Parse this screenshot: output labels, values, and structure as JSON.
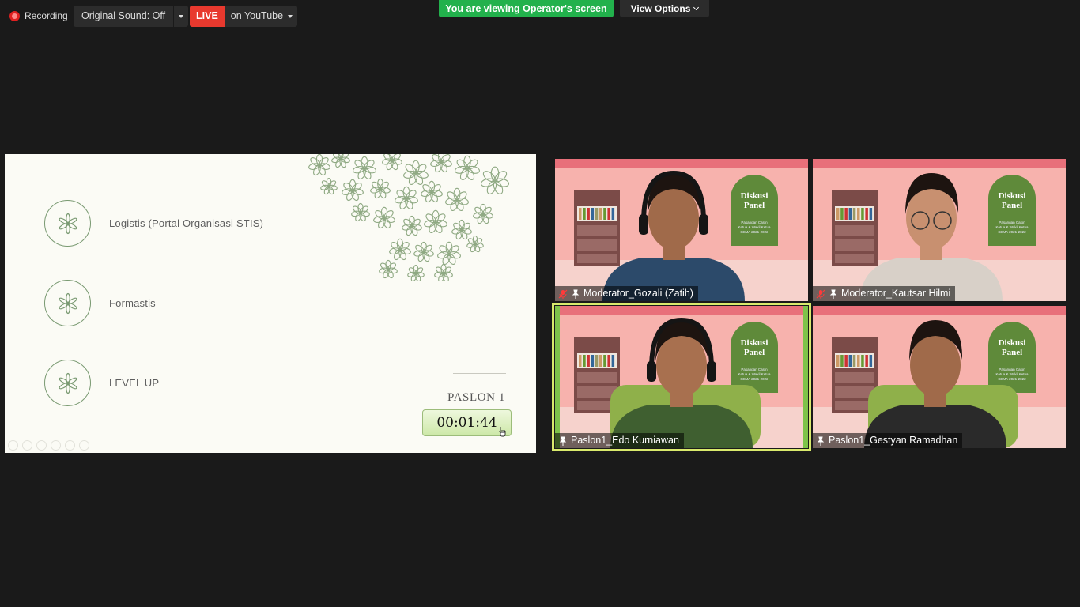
{
  "toolbar": {
    "recording_label": "Recording",
    "original_sound_label": "Original Sound: Off",
    "live_badge": "LIVE",
    "live_target": "on YouTube",
    "viewing_banner": "You are viewing Operator's screen",
    "view_options_label": "View Options"
  },
  "slide": {
    "items": [
      {
        "label": "Logistis (Portal Organisasi STIS)",
        "icon": "asterisk-flower-icon"
      },
      {
        "label": "Formastis",
        "icon": "asterisk-flower-icon"
      },
      {
        "label": "LEVEL UP",
        "icon": "asterisk-flower-icon"
      }
    ],
    "speaker_label": "PASLON 1",
    "timer": "00:01:44"
  },
  "participants": [
    {
      "name": "Moderator_Gozali (Zatih)",
      "muted": true,
      "active": false
    },
    {
      "name": "Moderator_Kautsar Hilmi",
      "muted": true,
      "active": false
    },
    {
      "name": "Paslon1_Edo Kurniawan",
      "muted": false,
      "active": true
    },
    {
      "name": "Paslon1_Gestyan Ramadhan",
      "muted": false,
      "active": false
    }
  ],
  "backdrop": {
    "poster_title_1": "Diskusi",
    "poster_title_2": "Panel",
    "poster_sub_1": "Pasangan Calon",
    "poster_sub_2": "Ketua & Wakil Ketua",
    "poster_sub_3": "SEMA 2021-2022"
  },
  "colors": {
    "live_red": "#e8392e",
    "banner_green": "#22b14c",
    "active_speaker": "#d9ea6c",
    "slide_bg": "#fbfbf5"
  }
}
